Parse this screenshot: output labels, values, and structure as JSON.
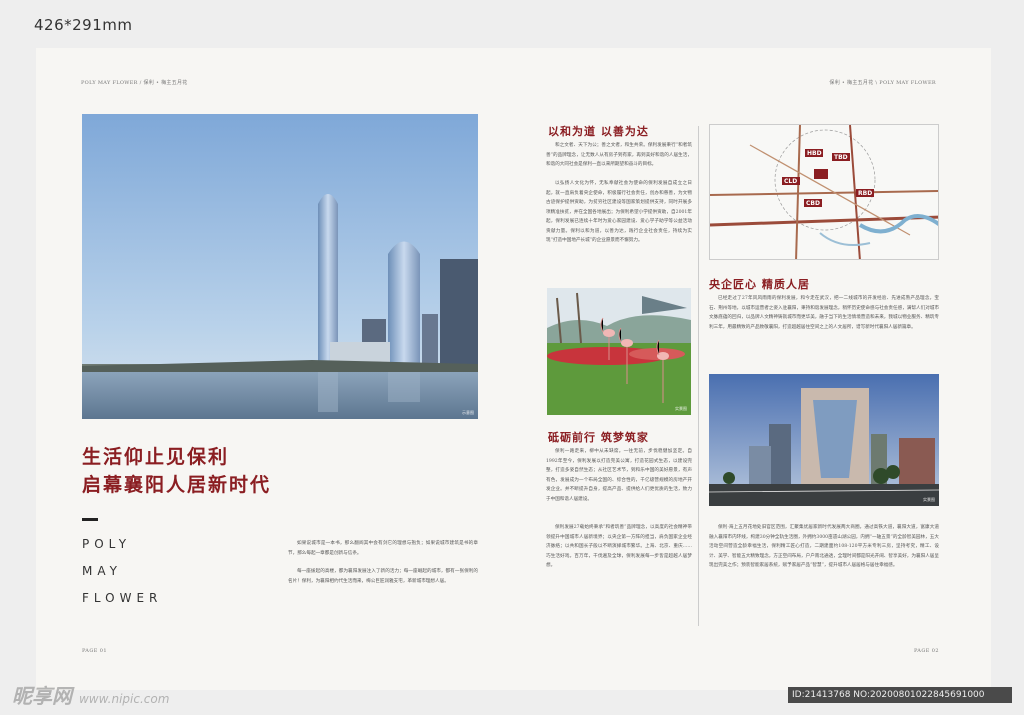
{
  "size_label": "426*291mm",
  "header": {
    "left": "POLY MAY FLOWER / 保利 • 梅主五月花",
    "right": "保利 • 梅主五月花 \\ POLY MAY FLOWER"
  },
  "left_page": {
    "photo_tag": "示意图",
    "headline_line1": "生活仰止见保利",
    "headline_line2": "启幕襄阳人居新时代",
    "brand_words": [
      "POLY",
      "MAY",
      "FLOWER"
    ],
    "paragraph_1": "如果说城市是一本书，那么翻阅其中会有剑它的理想与抱负；如果说城市建筑是书的章节，那么每起一章都是创新与信条。",
    "paragraph_2": "每一座拔起的高楼，都为襄阳发展注入了新的活力；每一座崛起的城市，都有一张保利的名片！保利，为襄阳相约代生活而来，梅公巨匠润雅支宅，革新城市理想人居。",
    "page_num": "PAGE 01"
  },
  "right_page": {
    "section_1_title": "以和为道 以善为达",
    "section_1_body": "和之文者、天下为公；善之文者，和生共荣。保利发展秉行“和者筑善”的品牌理念，让无数人从有房子到有家，再到美好和谐的人居生活，和谐的大同社会是保利一直以来所期望和奋斗的目标。",
    "section_1_body_2": "以弘扬人文化为怀，无私奉献社会为使命的保利发展自成立之日起，就一直肩负着央企使命，积极履行社会责任，创办和慈善，为文物古迹保护提供资助，为贫穷社区建设等国家策划提供支持，同时开展多项精准扶贫，并在全国各地展出；为保利希望小学提供资助，自2001年起，保利发展已连续十年时为爱心家园建设、爱心学子助学等公益活动贡献力量。保利以和为道，以善为达，践行企业社会责任，持续为实现“打造中国地产长城”的企业愿景而不懈努力。",
    "section_2_title": "砥砺前行 筑梦筑家",
    "section_2_body": "保利一路走来，柳中从未缺席。一往无前，步伐稳健加坚定。自1992年至今，保利发展以打造完美公寓，打造花园式生态，以建设完整，打造多姿自然生态；从社区艺术节，到和乐中国的美好愿景，有声有色，发展成为一个布局全国的、综合性的，千亿级营规模的房地产开发企业。并不断提升自身，提高产品、提供给人们更优质的生活，致力于中国和谐人居建设。",
    "section_2_body_2": "保利发展27载始终秉承“和者筑善”品牌理念，以高度的社会精神带领提升中国城市人居新境界；以央企第一方阵的担当，肩负国家企业经济脉络；以共和国长子般以不断演绎城市繁华。上海、北京、重庆……巧生活好戏，百万年，干伐遍及全球，保利发展每一步皆是超越人居梦想。",
    "photo_2_tag": "实景图",
    "section_3_title": "央企匠心 精质人居",
    "section_3_body": "已经走过了27年风风雨雨的保利发展，和今走在武汉，把一二线城市的开发经验、先进成熟产品理念，宝石、荆州等地，以城市运营者之姿入驻襄阳，秉持和谐发展理念，稍怀历史使命感与社会责任感，满帮人们对城市文脉底蕴的回归，以品牌人文精神铸就城市而更华美，融于当下的生活情境营造和未来，我城以物业服务、精筑专利三年，用最精致的产品致敬襄阳，打造超越居住空间之上的人文居所，谱写新时代襄阳人居新篇章。",
    "photo_3_tag": "实景图",
    "section_4_body": "保利·海上五月花地处旧官区范围，汇聚集优居家新时代发展两大商圈，通过高铁大道，襄阳大道，富康大道融入襄阳市内环线，构建30分钟全轨生活圈，外拥约3000亩遗山湖公园，内拥“一轴五景”的全龄智美园林，五大活动空间营造全龄幸福生活，保利精工匠心打造，二期建面约108-120平方米专利三房，坚持考究，精工、设计、美学、智能五大精致理念，方正空间布局，户户南北通透，全理时间都是阳光开阔、智享美好，为襄阳人居呈现出完美之作；预装智能家居系统，赋予家居产品“智慧”，提升城市人居居格与居住幸福感。",
    "page_num": "PAGE 02",
    "map_labels": [
      "HBD",
      "TBD",
      "CLD",
      "CBD",
      "RBD"
    ]
  },
  "watermark": {
    "brand": "昵享网",
    "url": "www.nipic.com",
    "id_text": "ID:21413768 NO:20200801022845691000"
  }
}
